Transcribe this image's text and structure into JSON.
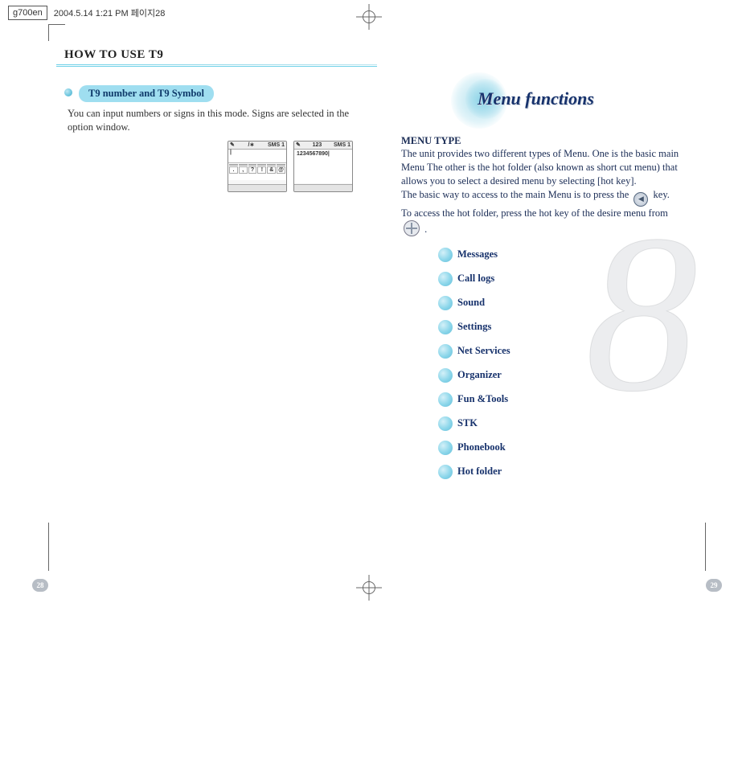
{
  "header": {
    "file": "g700en",
    "stamp": "2004.5.14 1:21 PM  페이지28"
  },
  "left": {
    "section_title": "HOW TO USE T9",
    "pill": "T9 number and T9 Symbol",
    "body": "You can input numbers or signs in this mode. Signs are selected in the option window.",
    "screen1": {
      "ind": "/∗",
      "label": "SMS 1"
    },
    "screen2": {
      "ind": "123",
      "label": "SMS 1",
      "text": "1234567890|"
    },
    "sym": [
      " ",
      " ",
      " ",
      " ",
      " ",
      " ",
      ".",
      ",",
      "?",
      "!",
      "&",
      "@"
    ],
    "page": "28"
  },
  "right": {
    "hero": "Menu functions",
    "subhead": "MENU TYPE",
    "p1": "The unit provides two different types of Menu. One is the basic main Menu The other is the hot folder (also known as short cut menu) that allows you to select a desired menu by selecting [hot key].",
    "p2a": "The basic way to access to the main Menu is to press the",
    "p2b": "key.",
    "p3a": "To access the hot folder, press the hot key of the desire menu from",
    "p3b": ".",
    "menu": [
      "Messages",
      "Call logs",
      "Sound",
      "Settings",
      "Net Services",
      "Organizer",
      "Fun &Tools",
      "STK",
      "Phonebook",
      "Hot folder"
    ],
    "bg_digit": "8",
    "page": "29"
  }
}
